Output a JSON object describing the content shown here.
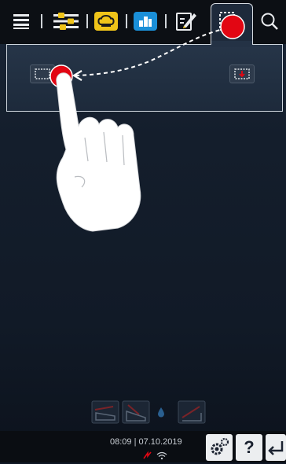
{
  "status": {
    "time": "08:09",
    "separator": "|",
    "date": "07.10.2019"
  },
  "toolbar": {
    "icons": [
      "menu-icon",
      "settings-sliders-icon",
      "chef-hat-icon",
      "intelligent-cooking-icon",
      "edit-icon",
      "cooking-paths-icon",
      "search-icon"
    ],
    "active_tab": "cooking-paths-icon"
  },
  "colors": {
    "accent_yellow": "#f0c419",
    "accent_blue": "#1a8fd8",
    "highlight_red": "#e20613",
    "background": "#141e2c"
  }
}
